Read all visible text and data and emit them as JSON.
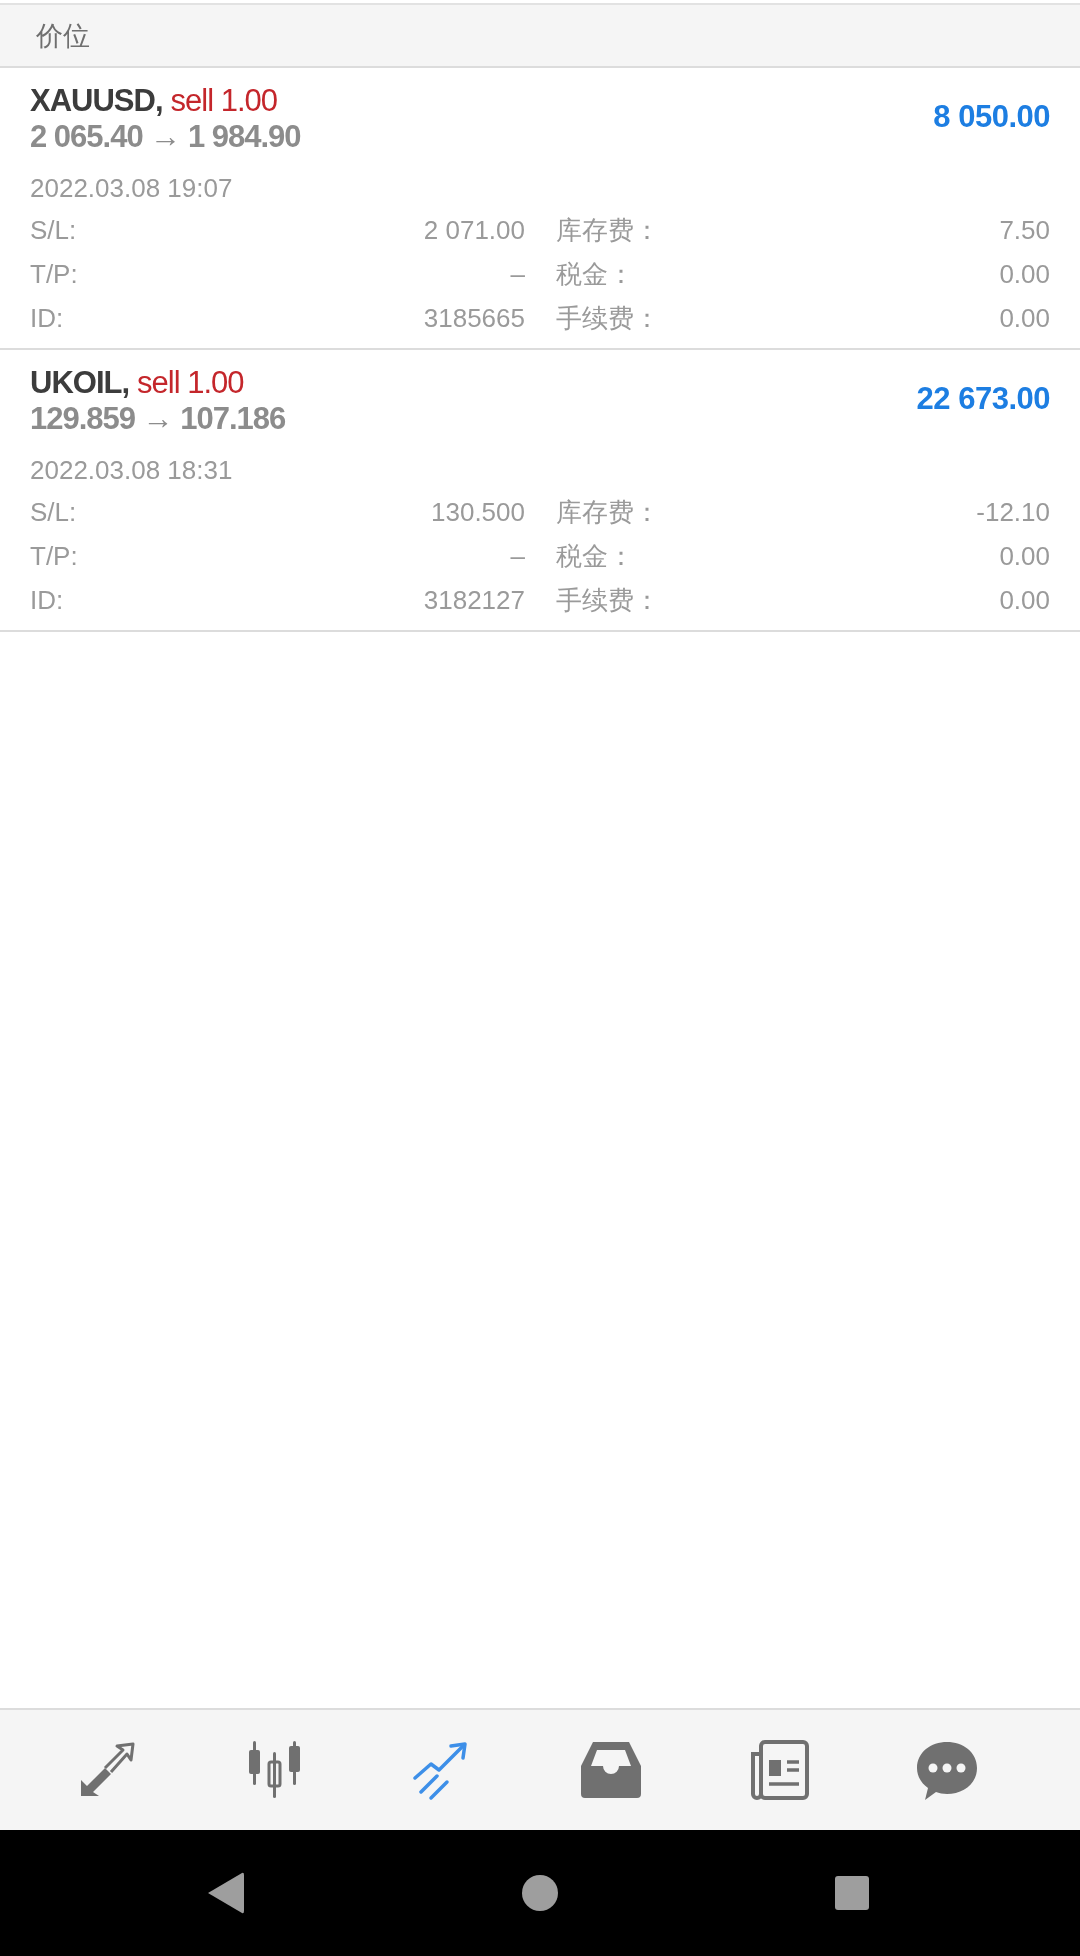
{
  "header": {
    "title": "价位"
  },
  "positions": [
    {
      "symbol": "XAUUSD,",
      "side": "sell 1.00",
      "prices": "2 065.40 → 1 984.90",
      "profit": "8 050.00",
      "time": "2022.03.08 19:07",
      "fields": [
        {
          "label": "S/L:",
          "value": "2 071.00",
          "label_2": "库存费：",
          "value_2": "7.50"
        },
        {
          "label": "T/P:",
          "value": "–",
          "label_2": "税金：",
          "value_2": "0.00"
        },
        {
          "label": "ID:",
          "value": "3185665",
          "label_2": "手续费：",
          "value_2": "0.00"
        }
      ]
    },
    {
      "symbol": "UKOIL,",
      "side": "sell 1.00",
      "prices": "129.859 → 107.186",
      "profit": "22 673.00",
      "time": "2022.03.08 18:31",
      "fields": [
        {
          "label": "S/L:",
          "value": "130.500",
          "label_2": "库存费：",
          "value_2": "-12.10"
        },
        {
          "label": "T/P:",
          "value": "–",
          "label_2": "税金：",
          "value_2": "0.00"
        },
        {
          "label": "ID:",
          "value": "3182127",
          "label_2": "手续费：",
          "value_2": "0.00"
        }
      ]
    }
  ],
  "nav": [
    {
      "kind": "quotes",
      "selected": false
    },
    {
      "kind": "chart",
      "selected": false
    },
    {
      "kind": "trade",
      "selected": true
    },
    {
      "kind": "history",
      "selected": false
    },
    {
      "kind": "news",
      "selected": false
    },
    {
      "kind": "messages",
      "selected": false
    }
  ],
  "system_nav": [
    {
      "kind": "back"
    },
    {
      "kind": "home"
    },
    {
      "kind": "recents"
    }
  ]
}
